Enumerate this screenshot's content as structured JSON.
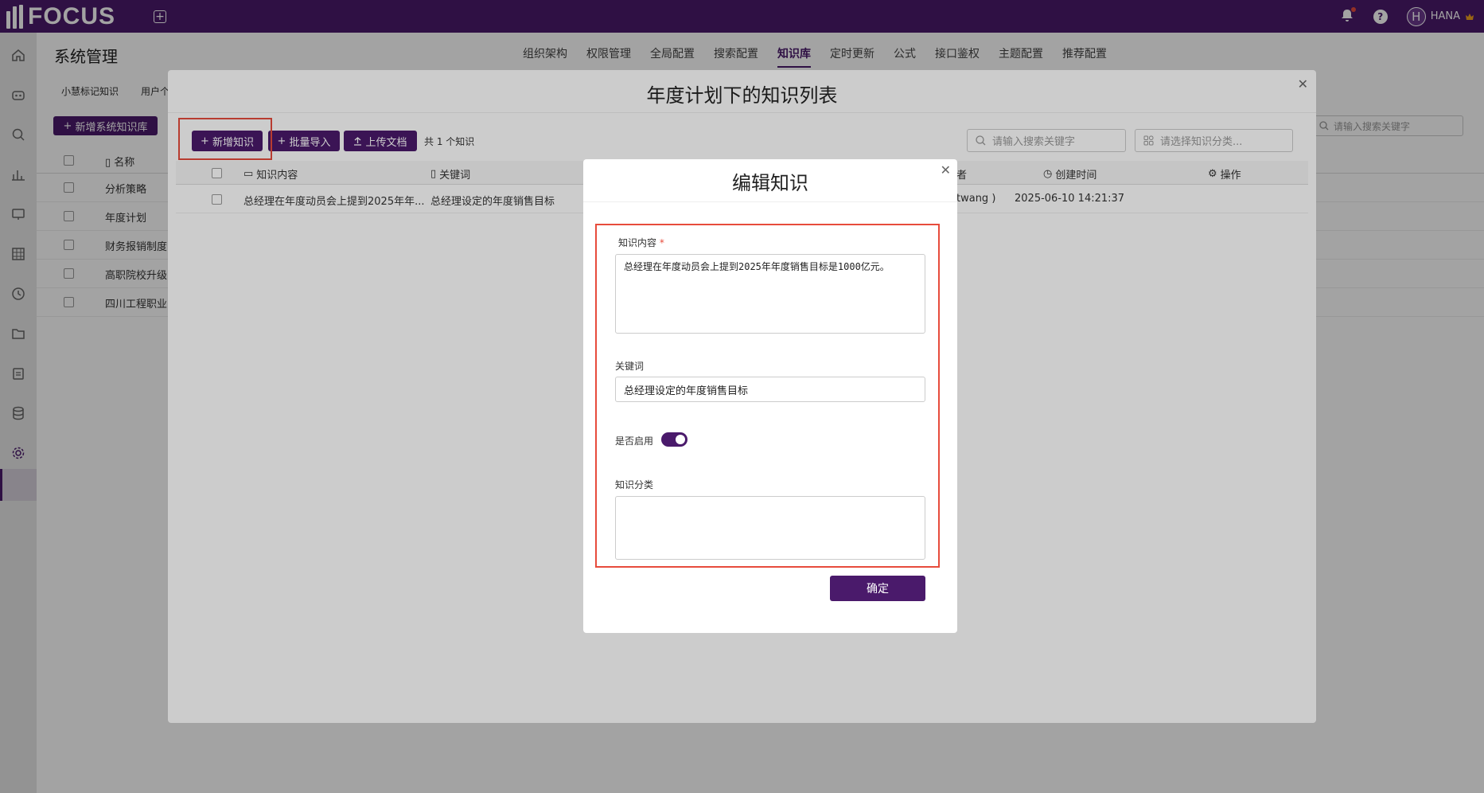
{
  "app": {
    "logo_text": "FOCUS",
    "user_initial": "H",
    "user_name": "HANA"
  },
  "page": {
    "title": "系统管理"
  },
  "nav": [
    "组织架构",
    "权限管理",
    "全局配置",
    "搜索配置",
    "知识库",
    "定时更新",
    "公式",
    "接口鉴权",
    "主题配置",
    "推荐配置"
  ],
  "sub_tabs": [
    "小慧标记知识",
    "用户个"
  ],
  "background": {
    "add_button": "新增系统知识库",
    "name_header": "名称",
    "rows": [
      "分析策略",
      "年度计划",
      "财务报销制度",
      "高职院校升级",
      "四川工程职业"
    ],
    "search_placeholder": "请输入搜索关键字"
  },
  "dialog1": {
    "title": "年度计划下的知识列表",
    "add_btn": "新增知识",
    "import_btn": "批量导入",
    "upload_btn": "上传文档",
    "count": "共 1 个知识",
    "search_placeholder": "请输入搜索关键字",
    "category_placeholder": "请选择知识分类...",
    "headers": {
      "content": "知识内容",
      "keyword": "关键词",
      "creator": "者",
      "created": "创建时间",
      "action": "操作"
    },
    "row": {
      "content": "总经理在年度动员会上提到2025年年...",
      "keyword": "总经理设定的年度销售目标",
      "creator": "twang )",
      "created": "2025-06-10 14:21:37"
    }
  },
  "dialog2": {
    "title": "编辑知识",
    "content_label": "知识内容",
    "content_value": "总经理在年度动员会上提到2025年年度销售目标是1000亿元。",
    "keyword_label": "关键词",
    "keyword_value": "总经理设定的年度销售目标",
    "enable_label": "是否启用",
    "enabled": true,
    "category_label": "知识分类",
    "confirm": "确定"
  },
  "colors": {
    "brand": "#4a1a6b",
    "highlight": "#e74c3c"
  }
}
